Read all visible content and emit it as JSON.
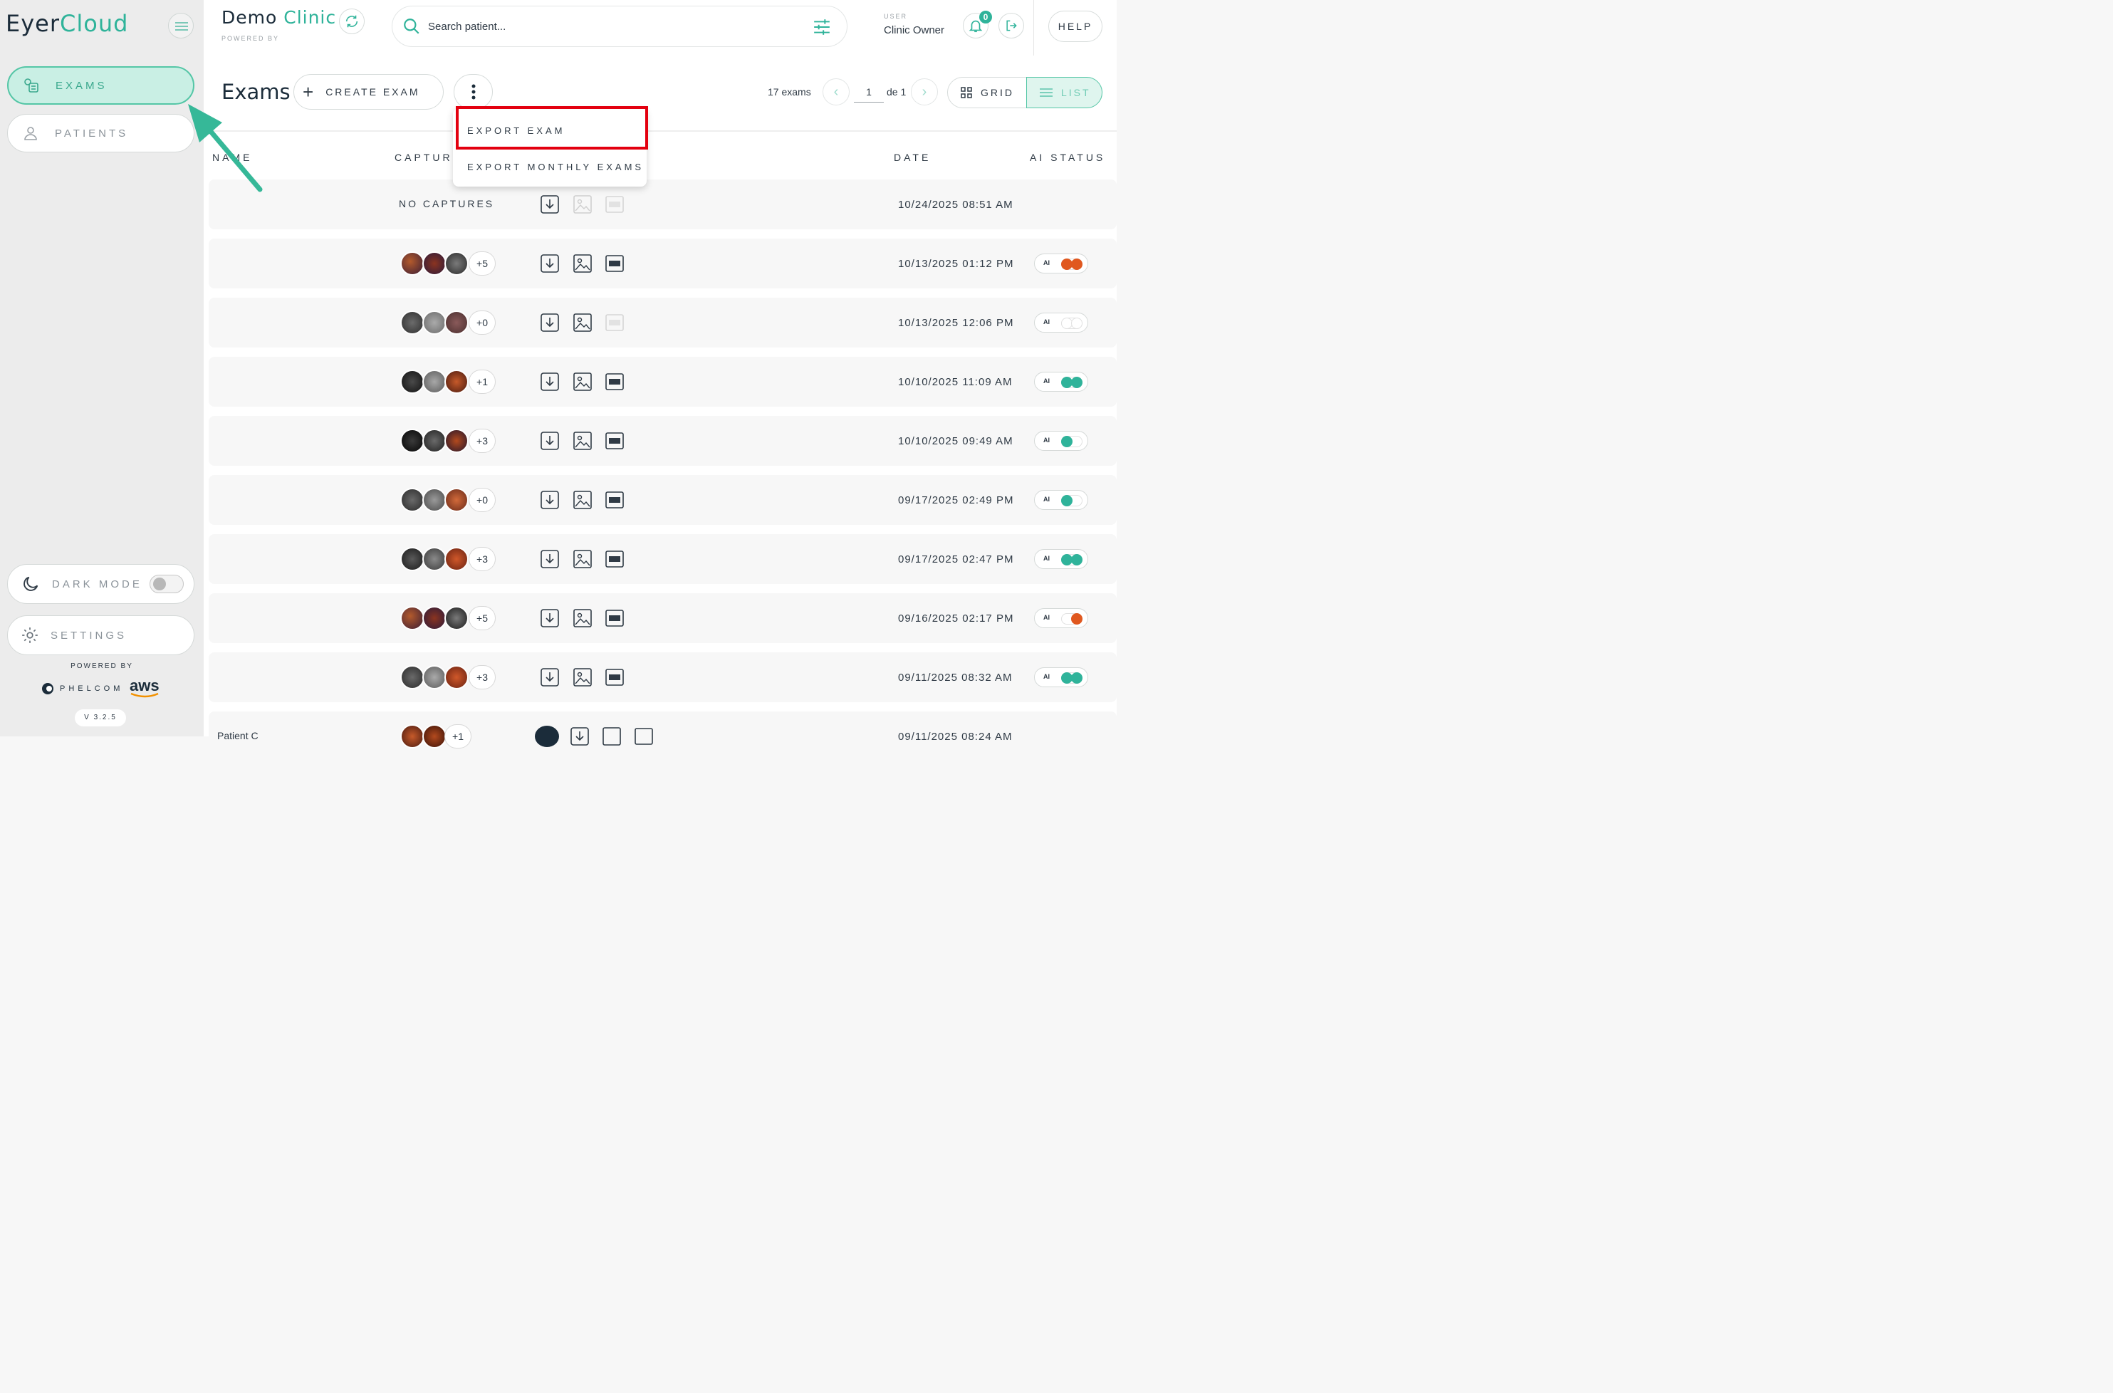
{
  "app": {
    "logo_part1": "Eyer",
    "logo_part2": "Cloud"
  },
  "sidebar": {
    "items": [
      {
        "label": "EXAMS"
      },
      {
        "label": "PATIENTS"
      }
    ],
    "dark_mode_label": "DARK MODE",
    "settings_label": "SETTINGS",
    "powered_by": "POWERED BY",
    "phelcom": "PHELCOM",
    "aws": "aws",
    "version": "V 3.2.5"
  },
  "header": {
    "clinic_part1": "Demo",
    "clinic_part2": "Clinic",
    "powered_by": "POWERED BY",
    "search_placeholder": "Search patient...",
    "user_label": "USER",
    "user_name": "Clinic Owner",
    "notifications": "0",
    "help": "HELP"
  },
  "toolbar": {
    "title": "Exams",
    "create_label": "CREATE EXAM",
    "count": "17 exams",
    "page": "1",
    "of": "de 1",
    "grid_label": "GRID",
    "list_label": "LIST"
  },
  "menu": {
    "export_exam": "EXPORT EXAM",
    "export_monthly": "EXPORT MONTHLY EXAMS"
  },
  "table": {
    "columns": {
      "name": "NAME",
      "captures": "CAPTURES",
      "date": "DATE",
      "ai_status": "AI STATUS"
    },
    "no_captures": "NO CAPTURES",
    "ai_label": "AI",
    "last_row_name": "Patient C",
    "rows": [
      {
        "captures_more": "",
        "date": "10/24/2025 08:51 AM",
        "ai": "none"
      },
      {
        "captures_more": "+5",
        "date": "10/13/2025 01:12 PM",
        "ai": "orange-full"
      },
      {
        "captures_more": "+0",
        "date": "10/13/2025 12:06 PM",
        "ai": "empty"
      },
      {
        "captures_more": "+1",
        "date": "10/10/2025 11:09 AM",
        "ai": "green-full"
      },
      {
        "captures_more": "+3",
        "date": "10/10/2025 09:49 AM",
        "ai": "green-left"
      },
      {
        "captures_more": "+0",
        "date": "09/17/2025 02:49 PM",
        "ai": "green-left"
      },
      {
        "captures_more": "+3",
        "date": "09/17/2025 02:47 PM",
        "ai": "green-full"
      },
      {
        "captures_more": "+5",
        "date": "09/16/2025 02:17 PM",
        "ai": "orange-right"
      },
      {
        "captures_more": "+3",
        "date": "09/11/2025 08:32 AM",
        "ai": "green-full"
      },
      {
        "captures_more": "+1",
        "date": "09/11/2025 08:24 AM",
        "ai": "none"
      }
    ]
  },
  "colors": {
    "accent": "#2fb39a",
    "orange": "#e0581f",
    "highlight": "#e3000f"
  }
}
